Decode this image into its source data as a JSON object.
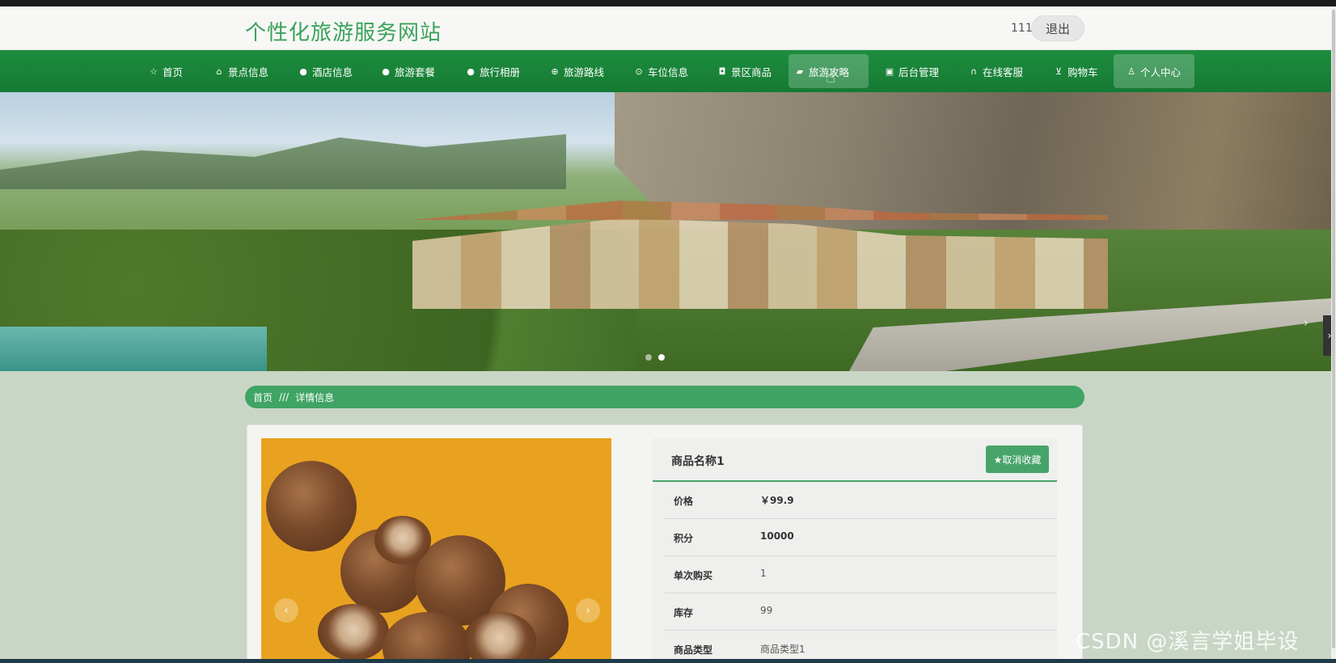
{
  "header": {
    "site_title": "个性化旅游服务网站",
    "username": "111",
    "logout_label": "退出"
  },
  "nav": {
    "items": [
      {
        "label": "首页",
        "icon": "star-icon"
      },
      {
        "label": "景点信息",
        "icon": "bag-icon"
      },
      {
        "label": "酒店信息",
        "icon": "info-icon"
      },
      {
        "label": "旅游套餐",
        "icon": "help-icon"
      },
      {
        "label": "旅行相册",
        "icon": "info-icon"
      },
      {
        "label": "旅游路线",
        "icon": "globe-icon"
      },
      {
        "label": "车位信息",
        "icon": "clock-icon"
      },
      {
        "label": "景区商品",
        "icon": "camera-icon"
      },
      {
        "label": "旅游攻略",
        "icon": "car-icon"
      },
      {
        "label": "后台管理",
        "icon": "briefcase-icon"
      },
      {
        "label": "在线客服",
        "icon": "headset-icon"
      },
      {
        "label": "购物车",
        "icon": "cart-icon"
      },
      {
        "label": "个人中心",
        "icon": "user-icon"
      }
    ]
  },
  "breadcrumb": {
    "home": "首页",
    "separator": "///",
    "current": "详情信息"
  },
  "product": {
    "name": "商品名称1",
    "favorite_label": "★取消收藏",
    "rows": [
      {
        "label": "价格",
        "value": "￥99.9"
      },
      {
        "label": "积分",
        "value": "10000"
      },
      {
        "label": "单次购买",
        "value": "1"
      },
      {
        "label": "库存",
        "value": "99"
      },
      {
        "label": "商品类型",
        "value": "商品类型1"
      }
    ]
  },
  "watermark": "CSDN @溪言学姐毕设",
  "colors": {
    "nav_green": "#1e8d3f",
    "accent_green": "#3fa464",
    "title_green": "#3aa25b"
  }
}
